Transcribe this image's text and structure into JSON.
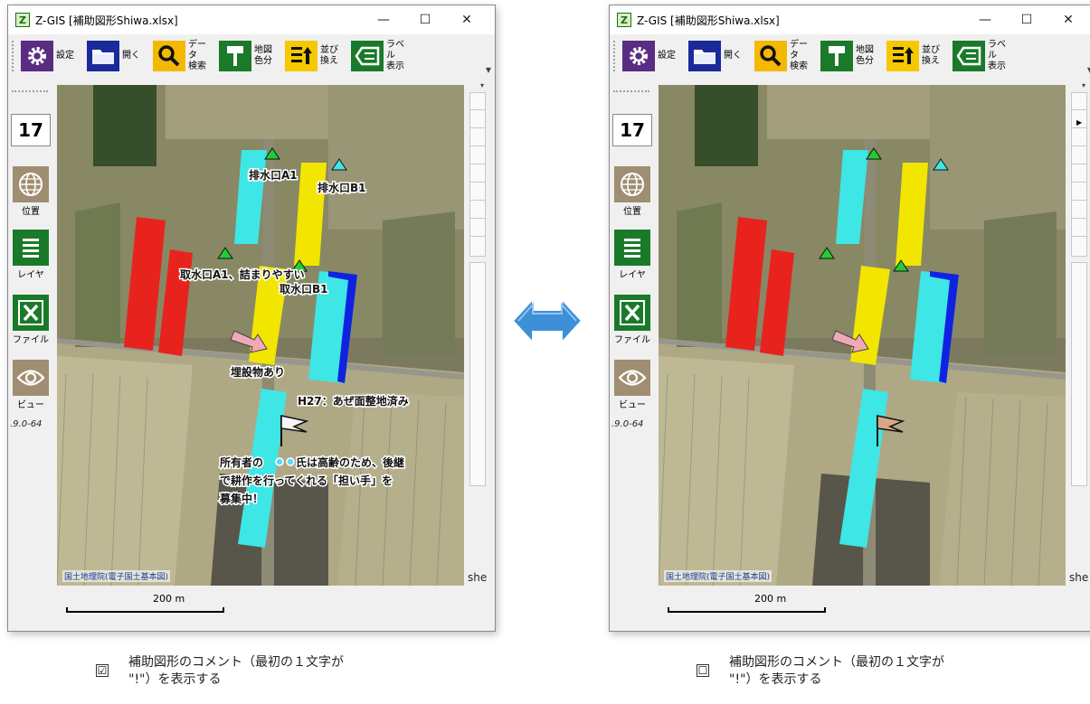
{
  "windows": [
    {
      "title": "Z-GIS [補助図形Shiwa.xlsx]",
      "app_icon": "Z",
      "toolbar": [
        {
          "icon": "gear-icon",
          "label": "設定",
          "color": "#5a2c82"
        },
        {
          "icon": "folder-icon",
          "label": "開く",
          "color": "#1a2a9a"
        },
        {
          "icon": "search-icon",
          "label": "データ\n検索",
          "color": "#f5b800"
        },
        {
          "icon": "paint-roller-icon",
          "label": "地図\n色分",
          "color": "#1a7a2a"
        },
        {
          "icon": "sort-icon",
          "label": "並び\n換え",
          "color": "#f5c800"
        },
        {
          "icon": "label-icon",
          "label": "ラベル\n表示",
          "color": "#1a7a2a"
        }
      ],
      "zoom_level": "17",
      "side_items": [
        {
          "icon": "globe-icon",
          "label": "位置"
        },
        {
          "icon": "layers-icon",
          "label": "レイヤ"
        },
        {
          "icon": "excel-icon",
          "label": "ファイル"
        },
        {
          "icon": "eye-icon",
          "label": "ビュー"
        }
      ],
      "version": ".9.0-64",
      "map_labels": {
        "drain_a1": "排水口A1",
        "drain_b1": "排水口B1",
        "intake_a1": "取水口A1、詰まりやすい",
        "intake_b1": "取水口B1",
        "buried": "埋設物あり",
        "h27": "H27：あぜ面整地済み",
        "comment_line1": "所有者の",
        "comment_line1b": "氏は高齢のため、後継",
        "comment_line2": "で耕作を行ってくれる「担い手」を",
        "comment_line3": "募集中！"
      },
      "attribution": "国土地理院(電子国土基本図)",
      "scale": "200 m",
      "sheet_tab": "she",
      "show_comments": true
    },
    {
      "title": "Z-GIS [補助図形Shiwa.xlsx]",
      "app_icon": "Z",
      "toolbar": [
        {
          "icon": "gear-icon",
          "label": "設定",
          "color": "#5a2c82"
        },
        {
          "icon": "folder-icon",
          "label": "開く",
          "color": "#1a2a9a"
        },
        {
          "icon": "search-icon",
          "label": "データ\n検索",
          "color": "#f5b800"
        },
        {
          "icon": "paint-roller-icon",
          "label": "地図\n色分",
          "color": "#1a7a2a"
        },
        {
          "icon": "sort-icon",
          "label": "並び\n換え",
          "color": "#f5c800"
        },
        {
          "icon": "label-icon",
          "label": "ラベル\n表示",
          "color": "#1a7a2a"
        }
      ],
      "zoom_level": "17",
      "side_items": [
        {
          "icon": "globe-icon",
          "label": "位置"
        },
        {
          "icon": "layers-icon",
          "label": "レイヤ"
        },
        {
          "icon": "excel-icon",
          "label": "ファイル"
        },
        {
          "icon": "eye-icon",
          "label": "ビュー"
        }
      ],
      "version": ".9.0-64",
      "attribution": "国土地理院(電子国土基本図)",
      "scale": "200 m",
      "sheet_tab": "she",
      "show_comments": false
    }
  ],
  "captions": {
    "checked": {
      "checkbox": "☑",
      "line1": "補助図形のコメント（最初の１文字が",
      "line2": "\"!\"）を表示する"
    },
    "unchecked": {
      "checkbox": "☐",
      "line1": "補助図形のコメント（最初の１文字が",
      "line2": "\"!\"）を表示する"
    }
  },
  "colors": {
    "cyan": "#3ee6e6",
    "yellow": "#f2e600",
    "red": "#e8231e",
    "blue": "#1022e0",
    "arrow": "#3d8fd8"
  }
}
